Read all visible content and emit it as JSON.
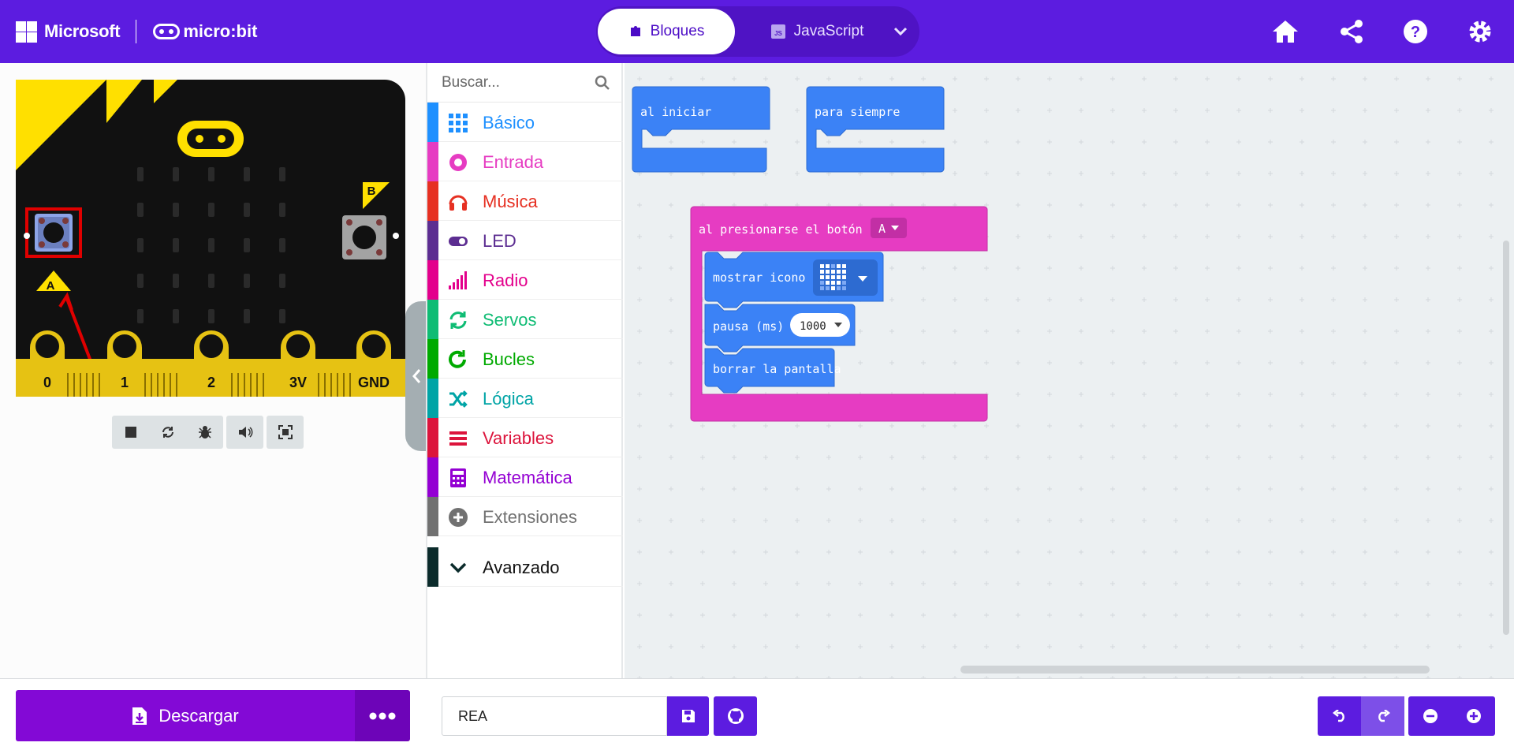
{
  "header": {
    "ms_label": "Microsoft",
    "product_label": "micro:bit",
    "tabs": [
      {
        "label": "Bloques",
        "active": true,
        "icon": "puzzle-icon"
      },
      {
        "label": "JavaScript",
        "active": false,
        "icon": "js-icon"
      }
    ],
    "right_icons": [
      "home-icon",
      "share-icon",
      "help-icon",
      "settings-icon"
    ],
    "accent": "#5c1ce0"
  },
  "simulator": {
    "pins": [
      "0",
      "1",
      "2",
      "3V",
      "GND"
    ],
    "button_a": "A",
    "button_b": "B",
    "controls": [
      "stop-icon",
      "restart-icon",
      "debug-icon",
      "sound-icon",
      "fullscreen-icon"
    ]
  },
  "toolbox": {
    "search_placeholder": "Buscar...",
    "categories": [
      {
        "label": "Básico",
        "color": "#1e90ff",
        "icon": "grid-icon"
      },
      {
        "label": "Entrada",
        "color": "#e63cc2",
        "icon": "target-icon"
      },
      {
        "label": "Música",
        "color": "#e63022",
        "icon": "headphones-icon"
      },
      {
        "label": "LED",
        "color": "#5c2d91",
        "icon": "toggle-icon"
      },
      {
        "label": "Radio",
        "color": "#e3008c",
        "icon": "signal-icon"
      },
      {
        "label": "Servos",
        "color": "#0fbc74",
        "icon": "refresh-icon"
      },
      {
        "label": "Bucles",
        "color": "#00aa00",
        "icon": "loop-icon"
      },
      {
        "label": "Lógica",
        "color": "#00a4a6",
        "icon": "shuffle-icon"
      },
      {
        "label": "Variables",
        "color": "#dc143c",
        "icon": "list-icon"
      },
      {
        "label": "Matemática",
        "color": "#9400d3",
        "icon": "calculator-icon"
      },
      {
        "label": "Extensiones",
        "color": "#717171",
        "icon": "plus-circle-icon"
      }
    ],
    "advanced_label": "Avanzado",
    "advanced_color": "#0b2b2b"
  },
  "workspace": {
    "on_start": "al iniciar",
    "forever": "para siempre",
    "on_button": "al presionarse el botón",
    "button_value": "A",
    "show_icon": "mostrar icono",
    "pause": "pausa (ms)",
    "pause_value": "1000",
    "clear": "borrar la pantalla",
    "block_blue": "#3b82f6",
    "block_pink": "#e63cc2"
  },
  "footer": {
    "download_label": "Descargar",
    "project_name": "REA"
  }
}
